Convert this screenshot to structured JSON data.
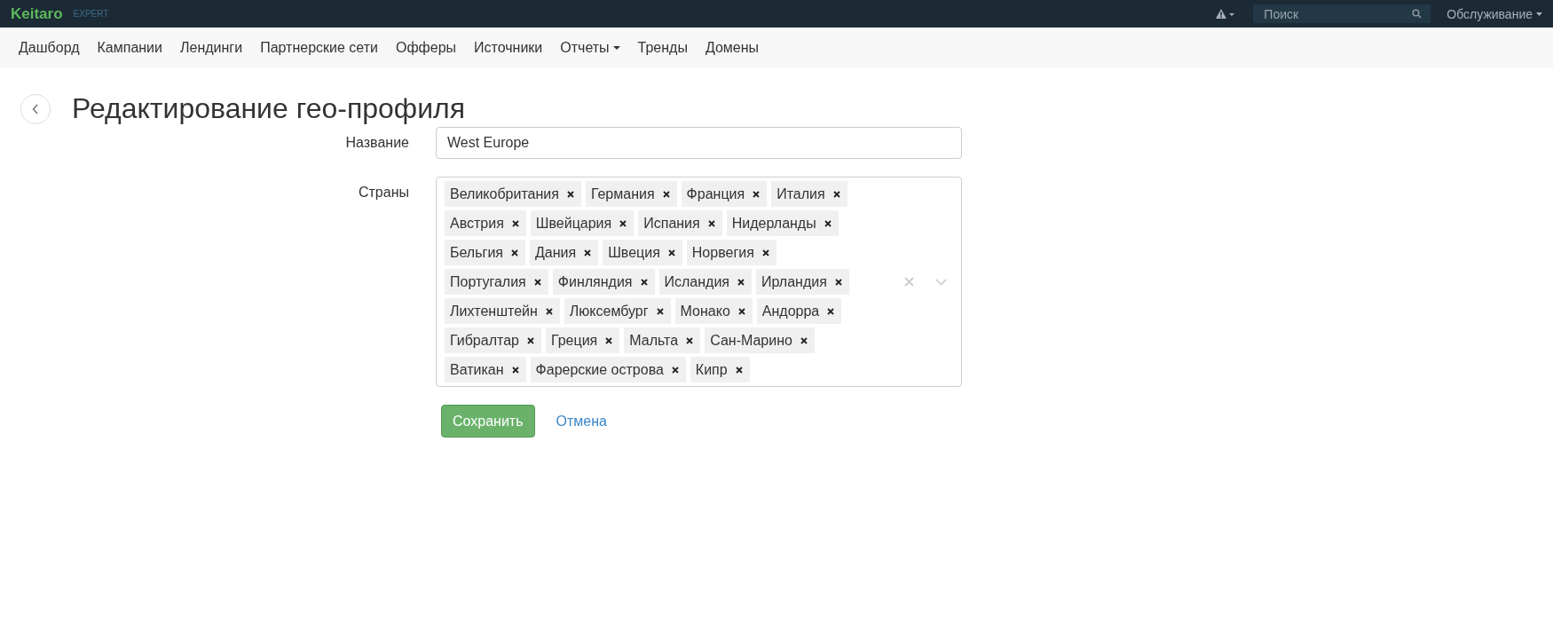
{
  "topbar": {
    "logo": "Keitaro",
    "edition": "EXPERT",
    "search": {
      "placeholder": "Поиск"
    },
    "user_menu": "Обслуживание"
  },
  "nav": [
    {
      "label": "Дашборд",
      "dropdown": false
    },
    {
      "label": "Кампании",
      "dropdown": false
    },
    {
      "label": "Лендинги",
      "dropdown": false
    },
    {
      "label": "Партнерские сети",
      "dropdown": false
    },
    {
      "label": "Офферы",
      "dropdown": false
    },
    {
      "label": "Источники",
      "dropdown": false
    },
    {
      "label": "Отчеты",
      "dropdown": true
    },
    {
      "label": "Тренды",
      "dropdown": false
    },
    {
      "label": "Домены",
      "dropdown": false
    }
  ],
  "page_title": "Редактирование гео-профиля",
  "form": {
    "name_label": "Название",
    "name_value": "West Europe",
    "countries_label": "Страны",
    "countries": [
      "Великобритания",
      "Германия",
      "Франция",
      "Италия",
      "Австрия",
      "Швейцария",
      "Испания",
      "Нидерланды",
      "Бельгия",
      "Дания",
      "Швеция",
      "Норвегия",
      "Португалия",
      "Финляндия",
      "Исландия",
      "Ирландия",
      "Лихтенштейн",
      "Люксембург",
      "Монако",
      "Андорра",
      "Гибралтар",
      "Греция",
      "Мальта",
      "Сан-Марино",
      "Ватикан",
      "Фарерские острова",
      "Кипр"
    ],
    "save": "Сохранить",
    "cancel": "Отмена"
  }
}
